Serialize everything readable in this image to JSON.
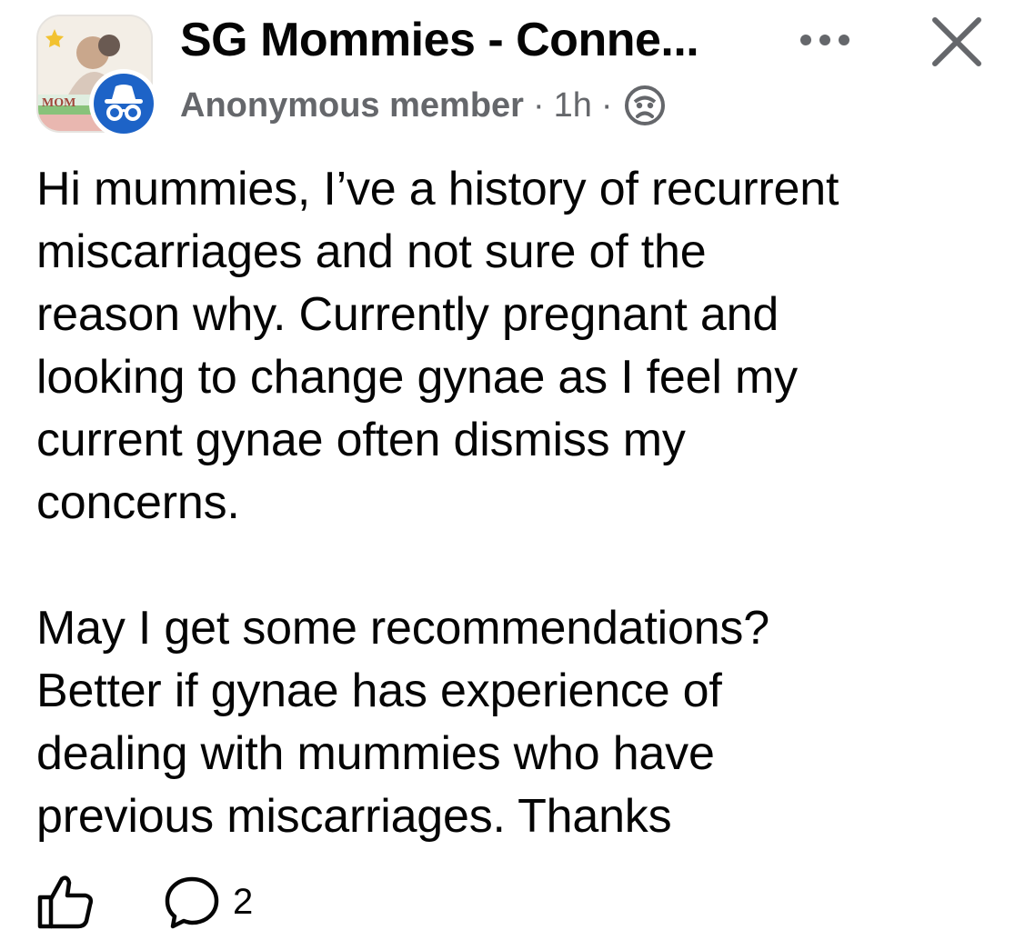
{
  "post": {
    "group_name": "SG Mommies - Conne...",
    "author": "Anonymous member",
    "separator": "·",
    "time": "1h",
    "privacy_icon": "anonymous-face-icon",
    "more_icon": "more-options-icon",
    "close_icon": "close-icon",
    "body_paragraphs": [
      "Hi mummies, I’ve a history of recurrent\nmiscarriages and not sure of the\nreason why. Currently pregnant and\nlooking to change gynae as I feel my\ncurrent gynae often dismiss my\nconcerns.",
      "May I get some recommendations?\nBetter if gynae has experience of\ndealing with mummies who have\nprevious miscarriages. Thanks"
    ],
    "actions": {
      "like_icon": "thumbs-up-icon",
      "comment_icon": "comment-icon",
      "comment_count": "2"
    }
  },
  "colors": {
    "text_primary": "#050505",
    "text_secondary": "#65676b",
    "anonymous_badge": "#1d63c7"
  }
}
